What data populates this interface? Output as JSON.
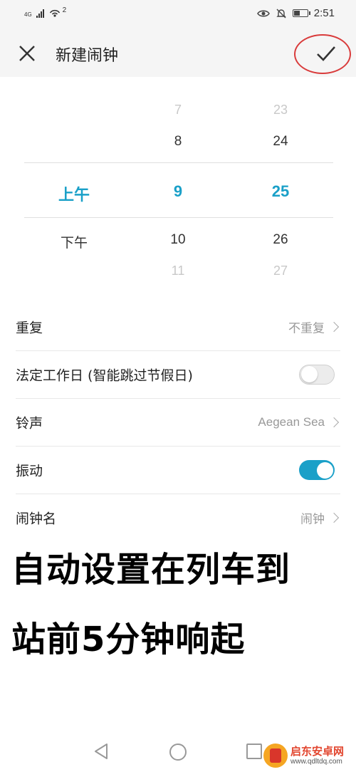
{
  "status_bar": {
    "network_type": "4G",
    "hotspot_count": "2",
    "time": "2:51",
    "battery_level": 0.4
  },
  "header": {
    "title": "新建闹钟",
    "close_icon": "close-icon",
    "confirm_icon": "checkmark-icon"
  },
  "time_picker": {
    "period": {
      "options": [
        "上午",
        "下午"
      ],
      "selected": "上午"
    },
    "hour": {
      "above": [
        "7",
        "8"
      ],
      "selected": "9",
      "below": [
        "10",
        "11"
      ]
    },
    "minute": {
      "above": [
        "23",
        "24"
      ],
      "selected": "25",
      "below": [
        "26",
        "27"
      ]
    }
  },
  "settings": {
    "repeat": {
      "label": "重复",
      "value": "不重复"
    },
    "workday": {
      "label": "法定工作日 (智能跳过节假日)",
      "enabled": false
    },
    "ringtone": {
      "label": "铃声",
      "value": "Aegean Sea"
    },
    "vibrate": {
      "label": "振动",
      "enabled": true
    },
    "alarm_name": {
      "label": "闹钟名",
      "value": "闹钟"
    }
  },
  "caption": {
    "line1": "自动设置在列车到",
    "line2": "站前5分钟响起"
  },
  "watermark": {
    "name": "启东安卓网",
    "url": "www.qdltdq.com"
  },
  "colors": {
    "accent": "#1aa0c8",
    "annotation": "#d93b3b"
  }
}
